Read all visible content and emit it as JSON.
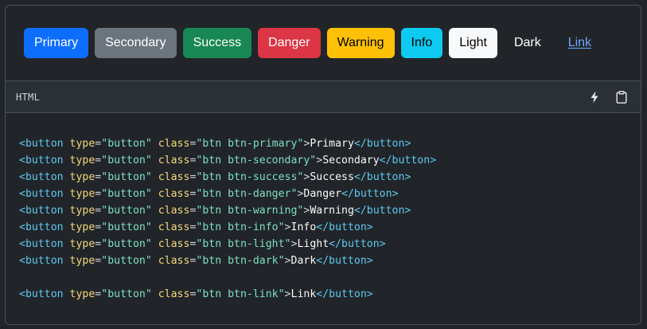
{
  "preview": {
    "buttons": [
      {
        "label": "Primary",
        "variant": "primary"
      },
      {
        "label": "Secondary",
        "variant": "secondary"
      },
      {
        "label": "Success",
        "variant": "success"
      },
      {
        "label": "Danger",
        "variant": "danger"
      },
      {
        "label": "Warning",
        "variant": "warning"
      },
      {
        "label": "Info",
        "variant": "info"
      },
      {
        "label": "Light",
        "variant": "light"
      },
      {
        "label": "Dark",
        "variant": "dark"
      },
      {
        "label": "Link",
        "variant": "link"
      }
    ]
  },
  "code_header": {
    "language": "HTML",
    "actions": [
      {
        "icon": "lightning-icon"
      },
      {
        "icon": "clipboard-icon"
      }
    ]
  },
  "code": {
    "tag_open": "<button",
    "attr_type": "type",
    "val_type": "\"button\"",
    "attr_class": "class",
    "tag_close_open": "</button",
    "lines_group1": [
      {
        "class_val": "\"btn btn-primary\"",
        "text": "Primary"
      },
      {
        "class_val": "\"btn btn-secondary\"",
        "text": "Secondary"
      },
      {
        "class_val": "\"btn btn-success\"",
        "text": "Success"
      },
      {
        "class_val": "\"btn btn-danger\"",
        "text": "Danger"
      },
      {
        "class_val": "\"btn btn-warning\"",
        "text": "Warning"
      },
      {
        "class_val": "\"btn btn-info\"",
        "text": "Info"
      },
      {
        "class_val": "\"btn btn-light\"",
        "text": "Light"
      },
      {
        "class_val": "\"btn btn-dark\"",
        "text": "Dark"
      }
    ],
    "lines_group2": [
      {
        "class_val": "\"btn btn-link\"",
        "text": "Link"
      }
    ]
  },
  "colors": {
    "background": "#212529",
    "border": "#495057",
    "header_bg": "#2b3035",
    "tag": "#5ec8f0",
    "attr": "#f5d77a",
    "string": "#7ee0c4"
  }
}
